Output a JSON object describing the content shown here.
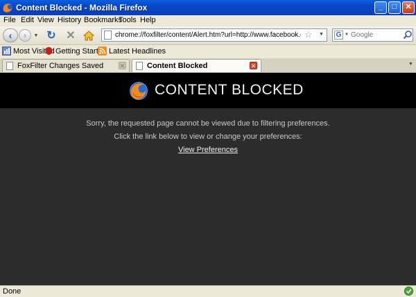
{
  "window": {
    "title": "Content Blocked - Mozilla Firefox",
    "controls": {
      "minimize": "_",
      "maximize": "□",
      "close": "✕"
    }
  },
  "menu": [
    "File",
    "Edit",
    "View",
    "History",
    "Bookmarks",
    "Tools",
    "Help"
  ],
  "navigation": {
    "back_icon": "back-arrow-icon",
    "forward_icon": "forward-arrow-icon",
    "reload_icon": "reload-icon",
    "stop_icon": "stop-icon",
    "home_icon": "home-icon"
  },
  "address_bar": {
    "value": "chrome://foxfilter/content/Alert.htm?url=http://www.facebook.com/&keyw"
  },
  "search_bar": {
    "placeholder": "Google",
    "engine_icon": "G"
  },
  "bookmarks": [
    "Most Visited",
    "Getting Started",
    "Latest Headlines"
  ],
  "tabs": [
    {
      "label": "FoxFilter Changes Saved",
      "active": false
    },
    {
      "label": "Content Blocked",
      "active": true
    }
  ],
  "page": {
    "heading": "CONTENT BLOCKED",
    "message1": "Sorry, the requested page cannot be viewed due to filtering preferences.",
    "message2": "Click the link below to view or change your preferences:",
    "link": "View Preferences"
  },
  "status": {
    "text": "Done"
  },
  "colors": {
    "title_bar": "#0a4fd0",
    "banner": "#000000",
    "content_background": "#2c2c2c"
  }
}
